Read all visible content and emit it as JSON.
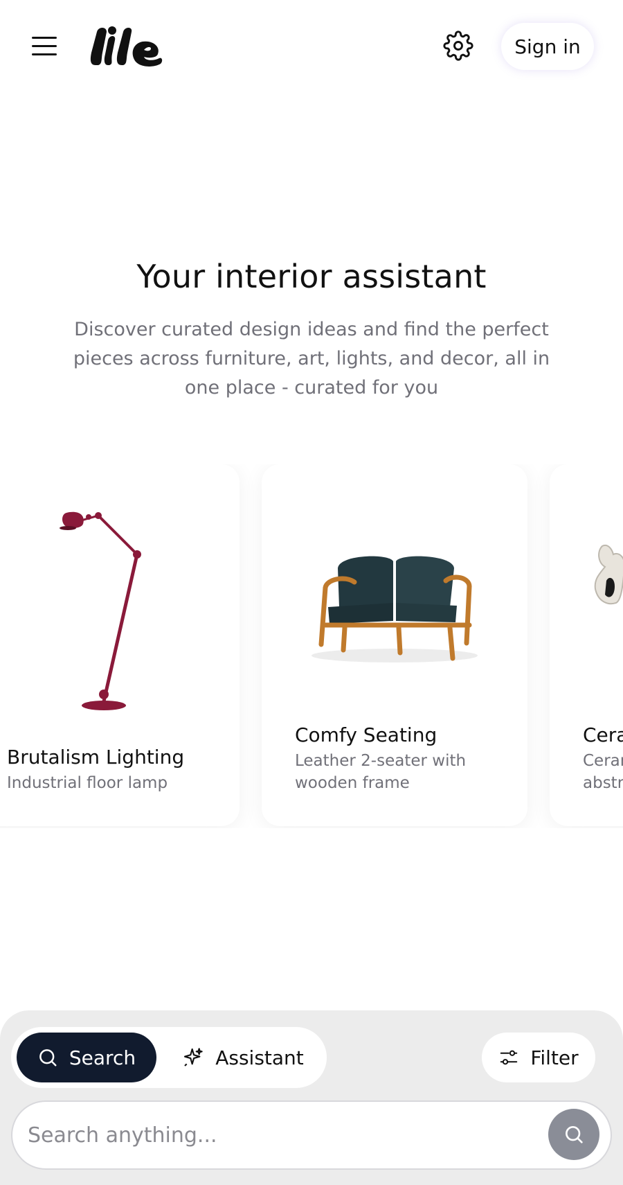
{
  "header": {
    "menu_icon": "hamburger-menu-icon",
    "logo_text": "lile",
    "settings_icon": "gear-icon",
    "signin_label": "Sign in"
  },
  "hero": {
    "title": "Your interior assistant",
    "description": "Discover curated design ideas and find the perfect pieces across furniture, art, lights, and decor, all in one place - curated for you"
  },
  "cards": [
    {
      "title": "Brutalism Lighting",
      "desc_line1": "Industrial floor lamp",
      "desc_line2": "",
      "image": "red-floor-lamp"
    },
    {
      "title": "Comfy Seating",
      "desc_line1": "Leather 2-seater with",
      "desc_line2": "wooden frame",
      "image": "leather-loveseat"
    },
    {
      "title": "Cera",
      "desc_line1": "Ceran",
      "desc_line2": "abstr",
      "image": "ceramic-vase"
    }
  ],
  "bottom": {
    "search_label": "Search",
    "assistant_label": "Assistant",
    "filter_label": "Filter",
    "search_placeholder": "Search anything...",
    "active_mode": "Search"
  },
  "colors": {
    "primary_dark": "#111b2e",
    "panel_bg": "#ececec",
    "muted_text": "#707078",
    "submit_bg": "#8a8d97",
    "lamp_red": "#8a1a3a"
  }
}
